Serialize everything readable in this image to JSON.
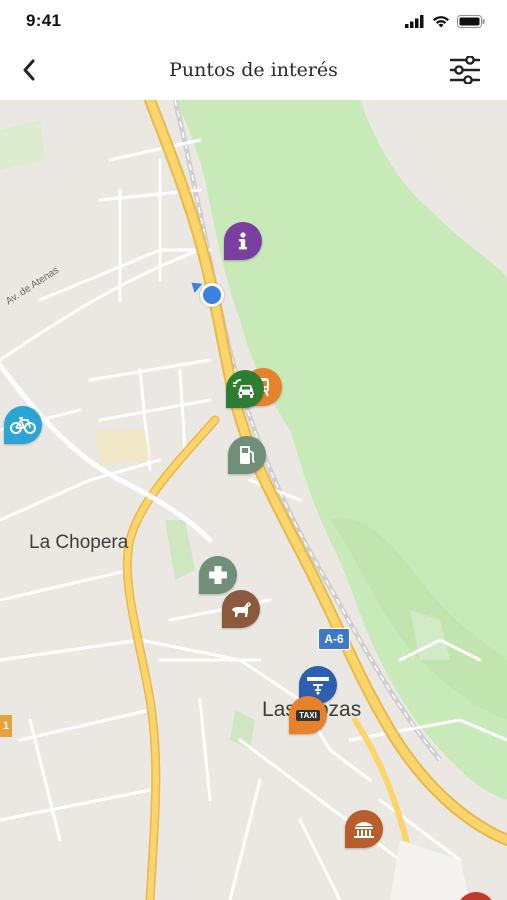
{
  "status_bar": {
    "time": "9:41"
  },
  "header": {
    "title": "Puntos de interés"
  },
  "map": {
    "labels": {
      "chopera": "La Chopera",
      "rozas": "Las Rozas",
      "atenas": "Av. de Atenas"
    },
    "road_shield": "A-6",
    "edge_shield": "1"
  },
  "pois": {
    "info": {
      "name": "Información",
      "color": "#7b3fa0"
    },
    "ev_charging": {
      "name": "Punto de recarga",
      "color": "#2e7d32"
    },
    "transport": {
      "name": "Transporte",
      "color": "#e7822a"
    },
    "gas_station": {
      "name": "Gasolinera",
      "color": "#6f8f79"
    },
    "bicycle": {
      "name": "Bicicletas",
      "color": "#2ba5d6"
    },
    "pharmacy": {
      "name": "Farmacia",
      "color": "#6f8f79"
    },
    "veterinary": {
      "name": "Veterinario",
      "color": "#8b5a3c"
    },
    "parking": {
      "name": "Parking",
      "color": "#2c5fae"
    },
    "taxi": {
      "name": "Taxi",
      "color": "#e7822a",
      "text": "TAXI"
    },
    "monument": {
      "name": "Monumento",
      "color": "#b85d2b"
    },
    "other": {
      "name": "Otro",
      "color": "#c0392b"
    }
  }
}
